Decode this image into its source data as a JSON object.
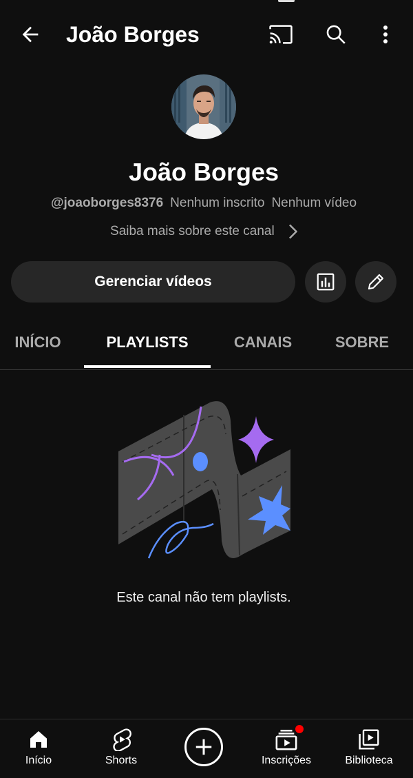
{
  "appbar": {
    "title": "João Borges",
    "icons": [
      "back-arrow-icon",
      "cast-icon",
      "search-icon",
      "more-vert-icon"
    ]
  },
  "channel": {
    "name": "João Borges",
    "handle": "@joaoborges8376",
    "subscribers": "Nenhum inscrito",
    "videos": "Nenhum vídeo",
    "about_link": "Saiba mais sobre este canal"
  },
  "actions": {
    "manage_label": "Gerenciar vídeos",
    "analytics_icon": "analytics-icon",
    "edit_icon": "pencil-icon"
  },
  "tabs": [
    {
      "label": "INÍCIO",
      "active": false
    },
    {
      "label": "PLAYLISTS",
      "active": true
    },
    {
      "label": "CANAIS",
      "active": false
    },
    {
      "label": "SOBRE",
      "active": false
    }
  ],
  "empty_state": {
    "message": "Este canal não tem playlists."
  },
  "bottom_nav": [
    {
      "label": "Início",
      "icon": "home-icon"
    },
    {
      "label": "Shorts",
      "icon": "shorts-icon"
    },
    {
      "label": "",
      "icon": "create-plus-icon"
    },
    {
      "label": "Inscrições",
      "icon": "subscriptions-icon",
      "badge": true
    },
    {
      "label": "Biblioteca",
      "icon": "library-icon"
    }
  ],
  "colors": {
    "background": "#0f0f0f",
    "surface": "#272727",
    "secondary_text": "#aaaaaa",
    "notification": "#ff0000",
    "illustration_purple": "#a56bf0",
    "illustration_blue": "#5b8fff"
  }
}
